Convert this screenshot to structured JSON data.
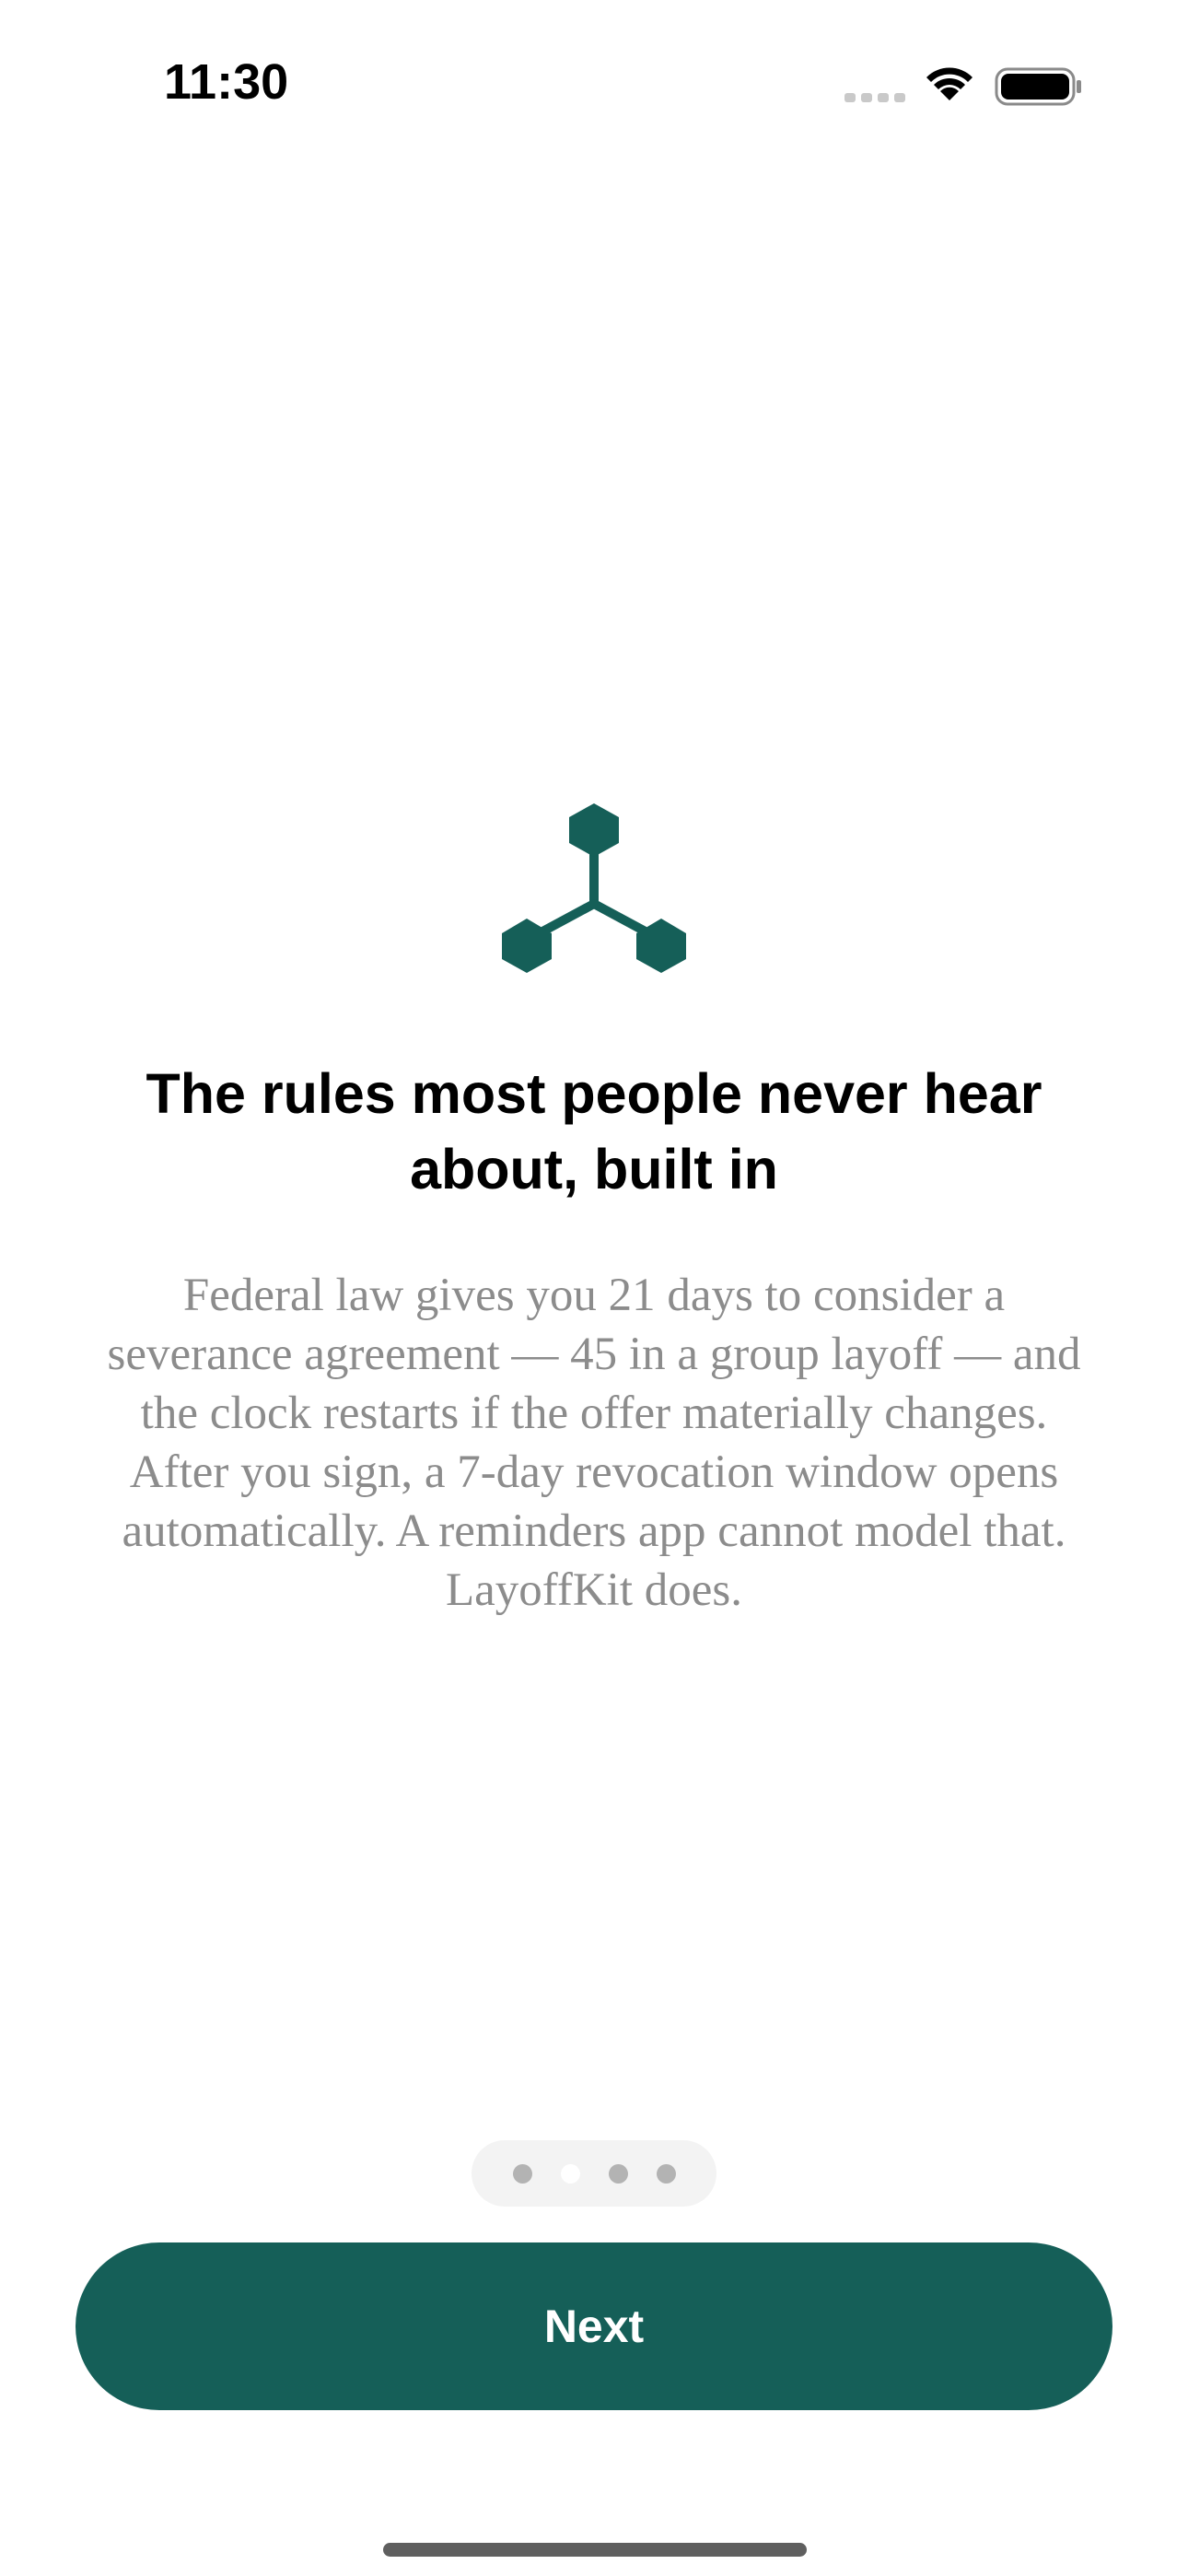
{
  "status_bar": {
    "time": "11:30",
    "icons": [
      "cellular-signal-icon",
      "wifi-icon",
      "battery-icon"
    ]
  },
  "onboarding": {
    "illustration_icon": "molecule-network-icon",
    "headline": "The rules most people never hear about, built in",
    "body": "Federal law gives you 21 days to consider a severance agreement — 45 in a group layoff — and the clock restarts if the offer materially changes. After you sign, a 7-day revocation window opens automatically. A reminders app cannot model that. LayoffKit does.",
    "page_indicator": {
      "total_pages": 4,
      "current_page": 2
    },
    "next_label": "Next"
  },
  "colors": {
    "accent": "#155f58",
    "body_text": "#8c8c8c",
    "headline_text": "#000000",
    "dot_inactive": "#b3b3b3",
    "dot_active": "#ffffff",
    "dots_background": "#f3f3f3"
  }
}
